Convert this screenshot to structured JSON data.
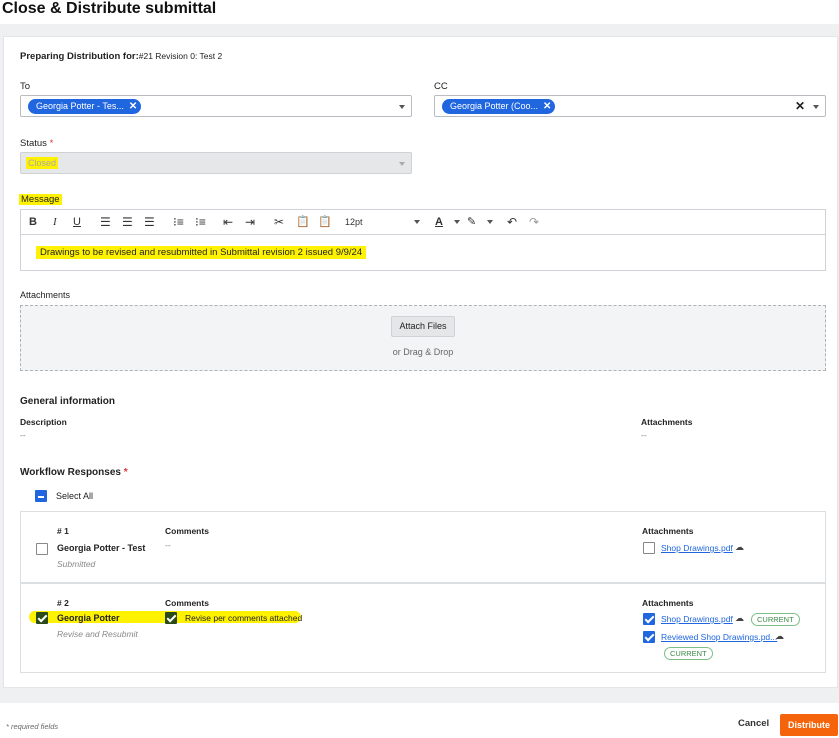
{
  "header": {
    "title": "Close & Distribute submittal"
  },
  "prep": {
    "label": "Preparing Distribution for:",
    "value": "#21 Revision 0: Test 2"
  },
  "to": {
    "label": "To",
    "chip": "Georgia Potter - Tes..."
  },
  "cc": {
    "label": "CC",
    "chip": "Georgia Potter (Coo..."
  },
  "status": {
    "label": "Status",
    "required_mark": "*",
    "value": "Closed"
  },
  "message": {
    "label": "Message",
    "font_size": "12pt",
    "text": "Drawings to be revised and resubmitted in Submittal revision 2 issued 9/9/24",
    "toolbar_icons": [
      "bold-icon",
      "italic-icon",
      "underline-icon",
      "align-left-icon",
      "align-center-icon",
      "align-right-icon",
      "bullet-list-icon",
      "numbered-list-icon",
      "outdent-icon",
      "indent-icon",
      "cut-icon",
      "paste-icon",
      "paste-text-icon",
      "font-size-select",
      "text-color-icon",
      "highlight-icon",
      "undo-icon",
      "redo-icon"
    ]
  },
  "attachments": {
    "label": "Attachments",
    "button": "Attach Files",
    "hint": "or Drag & Drop"
  },
  "general": {
    "title": "General information",
    "description_label": "Description",
    "description_value": "--",
    "attachments_label": "Attachments",
    "attachments_value": "--"
  },
  "workflow": {
    "title": "Workflow Responses",
    "required_mark": "*",
    "select_all": "Select All",
    "responses": [
      {
        "num": "# 1",
        "name": "Georgia Potter - Test",
        "status": "Submitted",
        "comments_label": "Comments",
        "comments": "--",
        "attachments_label": "Attachments",
        "checked": false,
        "files": [
          {
            "name": "Shop Drawings.pdf",
            "checked": false,
            "badge": ""
          }
        ]
      },
      {
        "num": "# 2",
        "name": "Georgia Potter",
        "status": "Revise and Resubmit",
        "comments_label": "Comments",
        "comments": "Revise per comments attached",
        "attachments_label": "Attachments",
        "checked": true,
        "files": [
          {
            "name": "Shop Drawings.pdf",
            "checked": true,
            "badge": "CURRENT"
          },
          {
            "name": "Reviewed Shop Drawings.pd...",
            "checked": true,
            "badge": "CURRENT"
          }
        ]
      }
    ]
  },
  "footer": {
    "required_note": "* required fields",
    "cancel": "Cancel",
    "distribute": "Distribute"
  },
  "colors": {
    "accent": "#2066df",
    "primary_button": "#f5640a",
    "highlight": "#fff200",
    "current_badge": "#3a8a45"
  }
}
